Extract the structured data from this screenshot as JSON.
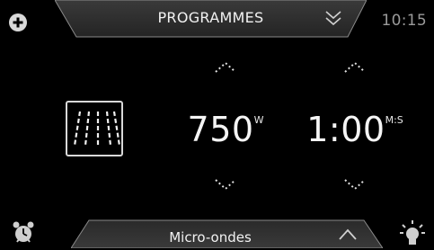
{
  "header": {
    "title": "PROGRAMMES",
    "time": "10:15",
    "icons": {
      "add": "plus-circle-icon",
      "collapse": "double-chevron-down-icon"
    }
  },
  "mode": {
    "icon": "microwave-waves-icon"
  },
  "power": {
    "value": "750",
    "unit": "W"
  },
  "timer": {
    "value": "1:00",
    "unit": "M:S"
  },
  "footer": {
    "title": "Micro-ondes",
    "icons": {
      "alarm": "alarm-clock-icon",
      "expand": "chevron-up-icon",
      "light": "lamp-icon"
    }
  },
  "colors": {
    "background": "#000000",
    "panel": "#333333",
    "text": "#ffffff",
    "muted": "#9a9a9a"
  }
}
